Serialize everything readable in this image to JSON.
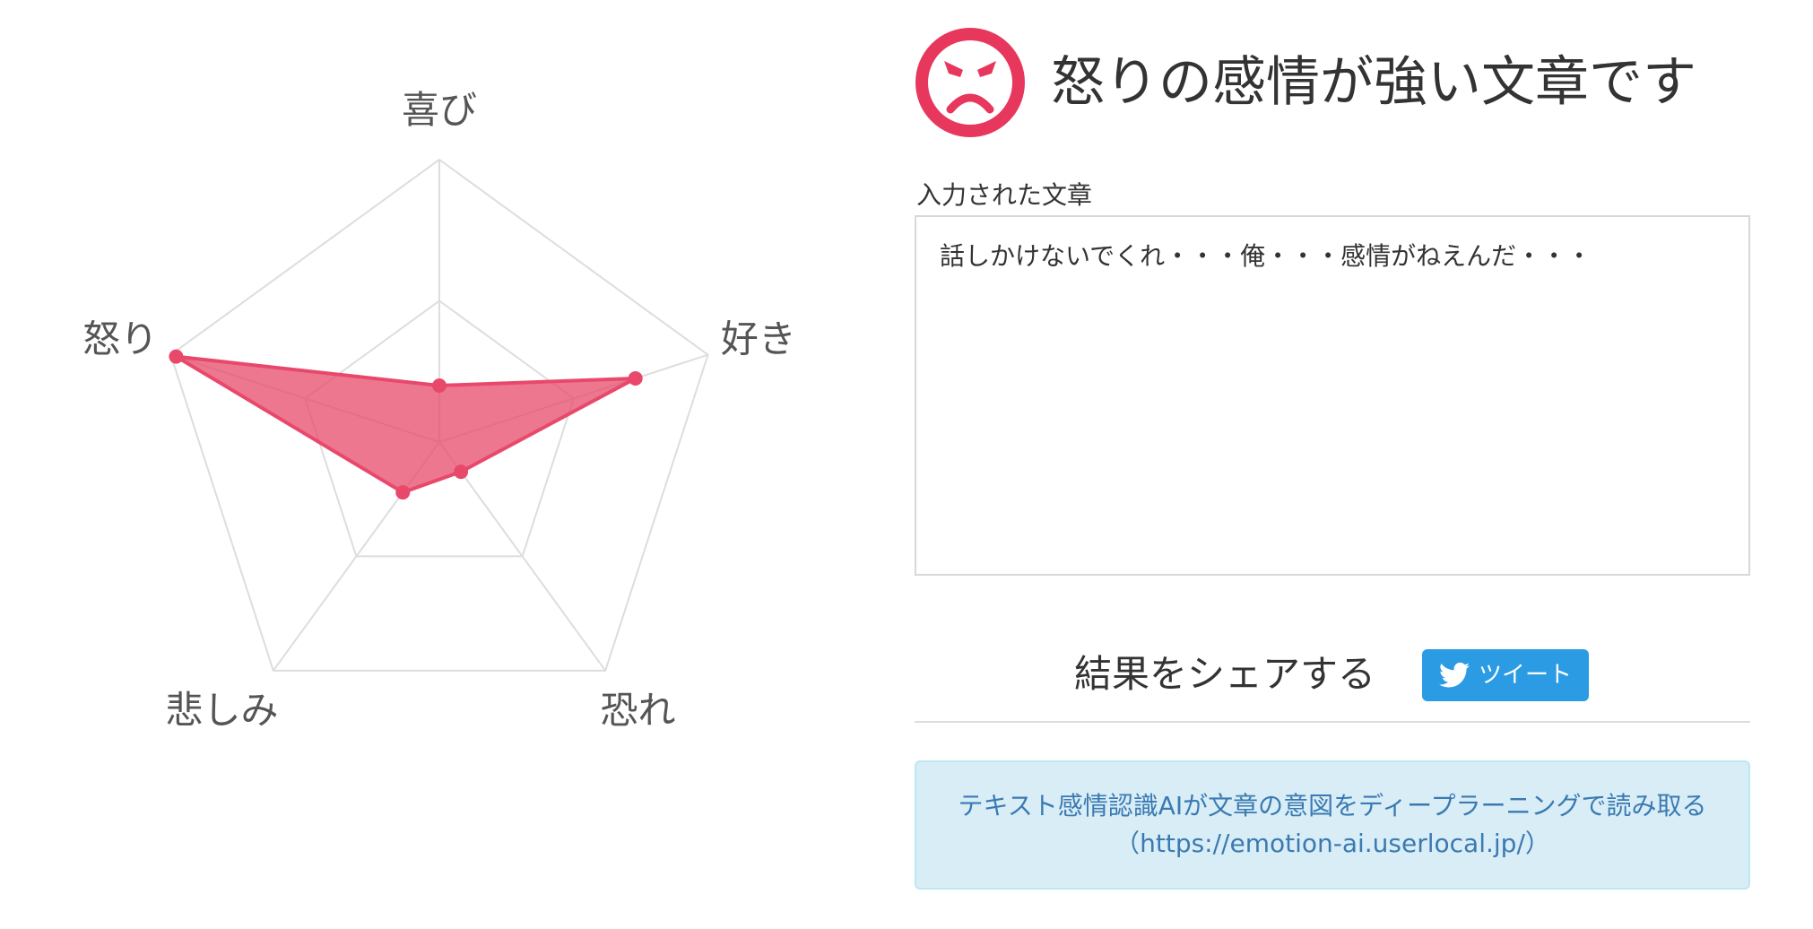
{
  "chart_data": {
    "type": "radar",
    "axes": [
      "喜び",
      "好き",
      "恐れ",
      "悲しみ",
      "怒り"
    ],
    "values": [
      0.2,
      0.73,
      0.13,
      0.22,
      0.98
    ],
    "range": [
      0,
      1
    ],
    "gridlines": 2,
    "grid": true,
    "legend": "none",
    "fill_color": "#e8496b",
    "fill_opacity": 0.75,
    "grid_color": "#dddddd"
  },
  "result": {
    "icon": "angry-face-icon",
    "icon_color": "#e8375d",
    "title": "怒りの感情が強い文章です"
  },
  "input": {
    "label": "入力された文章",
    "text": "話しかけないでくれ・・・俺・・・感情がねえんだ・・・"
  },
  "share": {
    "label": "結果をシェアする",
    "tweet_label": "ツイート",
    "tweet_color": "#2b9be4"
  },
  "info": {
    "line1": "テキスト感情認識AIが文章の意図をディープラーニングで読み取る",
    "line2": "（https://emotion-ai.userlocal.jp/）"
  }
}
